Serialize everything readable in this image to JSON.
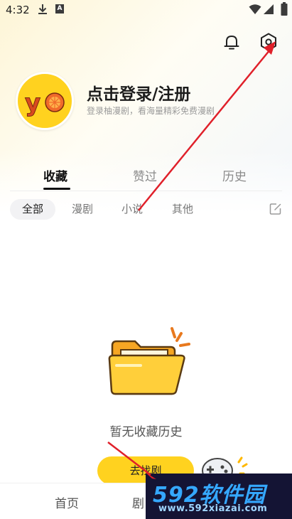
{
  "status_bar": {
    "time": "4:32",
    "notif_badge": "A"
  },
  "header": {
    "notification_icon": "bell-icon",
    "settings_icon": "settings-icon"
  },
  "profile": {
    "avatar_text": "yo",
    "login_title": "点击登录/注册",
    "login_subtitle": "登录柚漫剧，看海量精彩免费漫剧"
  },
  "tabs": [
    {
      "label": "收藏",
      "active": true
    },
    {
      "label": "赞过",
      "active": false
    },
    {
      "label": "历史",
      "active": false
    }
  ],
  "filters": [
    {
      "label": "全部",
      "active": true
    },
    {
      "label": "漫剧",
      "active": false
    },
    {
      "label": "小说",
      "active": false
    },
    {
      "label": "其他",
      "active": false
    }
  ],
  "empty_state": {
    "message": "暂无收藏历史",
    "button_label": "去找剧"
  },
  "bottom_nav": [
    {
      "label": "首页"
    },
    {
      "label": "剧"
    }
  ],
  "watermark": {
    "brand": "592软件园",
    "url": "www.592xiazai.com"
  },
  "colors": {
    "accent_yellow": "#ffd21f",
    "annotation_red": "#e0202a",
    "watermark_blue": "#35a8ff"
  }
}
